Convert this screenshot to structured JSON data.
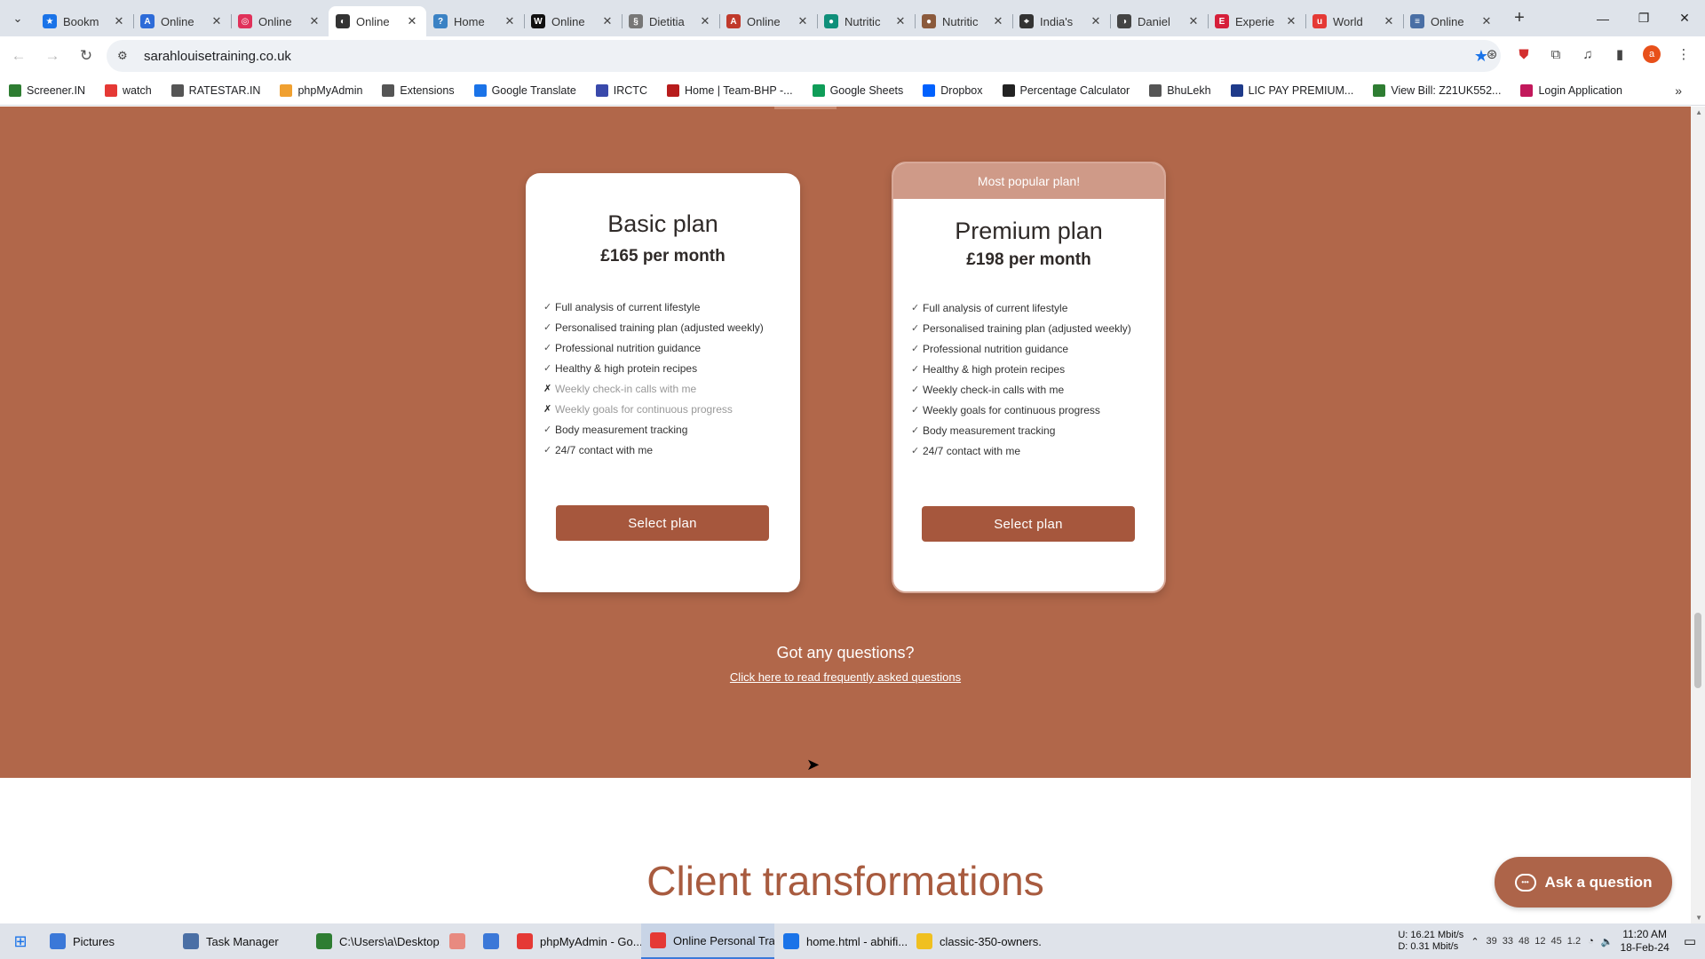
{
  "browser": {
    "tabs": [
      {
        "title": "Bookm",
        "color": "#1a73e8",
        "glyph": "★"
      },
      {
        "title": "Online",
        "color": "#2d6bd8",
        "glyph": "A"
      },
      {
        "title": "Online",
        "color": "#e0315a",
        "glyph": "◎"
      },
      {
        "title": "Online",
        "color": "#333333",
        "glyph": "◐",
        "active": true
      },
      {
        "title": "Home",
        "color": "#3b82c4",
        "glyph": "?"
      },
      {
        "title": "Online",
        "color": "#111111",
        "glyph": "W"
      },
      {
        "title": "Dietitia",
        "color": "#777777",
        "glyph": "§"
      },
      {
        "title": "Online",
        "color": "#c0392b",
        "glyph": "A"
      },
      {
        "title": "Nutritic",
        "color": "#0f8f7a",
        "glyph": "●"
      },
      {
        "title": "Nutritic",
        "color": "#8b5a3c",
        "glyph": "●"
      },
      {
        "title": "India's",
        "color": "#333333",
        "glyph": "⌖"
      },
      {
        "title": "Daniel",
        "color": "#444444",
        "glyph": "◑"
      },
      {
        "title": "Experie",
        "color": "#d61f3a",
        "glyph": "E"
      },
      {
        "title": "World",
        "color": "#e53935",
        "glyph": "u"
      },
      {
        "title": "Online",
        "color": "#4a6fa5",
        "glyph": "≡"
      }
    ],
    "new_tab": "+",
    "url": "sarahlouisetraining.co.uk",
    "bookmarks": [
      {
        "label": "Screener.IN",
        "color": "#2e7d32"
      },
      {
        "label": "watch",
        "color": "#e53935"
      },
      {
        "label": "RATESTAR.IN",
        "color": "#555555"
      },
      {
        "label": "phpMyAdmin",
        "color": "#f0a030"
      },
      {
        "label": "Extensions",
        "color": "#555555"
      },
      {
        "label": "Google Translate",
        "color": "#1a73e8"
      },
      {
        "label": "IRCTC",
        "color": "#3949ab"
      },
      {
        "label": "Home | Team-BHP -...",
        "color": "#b71c1c"
      },
      {
        "label": "Google Sheets",
        "color": "#0f9d58"
      },
      {
        "label": "Dropbox",
        "color": "#0061fe"
      },
      {
        "label": "Percentage Calculator",
        "color": "#222222"
      },
      {
        "label": "BhuLekh",
        "color": "#555555"
      },
      {
        "label": "LIC PAY PREMIUM...",
        "color": "#1e3a8a"
      },
      {
        "label": "View Bill: Z21UK552...",
        "color": "#2e7d32"
      },
      {
        "label": "Login Application",
        "color": "#c2185b"
      }
    ]
  },
  "pricing": {
    "accent": "#b1674a",
    "plans": [
      {
        "name": "Basic plan",
        "price": "£165 per month",
        "button": "Select plan",
        "features": [
          {
            "text": "Full analysis of current lifestyle",
            "included": true
          },
          {
            "text": "Personalised training plan (adjusted weekly)",
            "included": true
          },
          {
            "text": "Professional nutrition guidance",
            "included": true
          },
          {
            "text": "Healthy & high protein recipes",
            "included": true
          },
          {
            "text": "Weekly check-in calls with me",
            "included": false
          },
          {
            "text": "Weekly goals for continuous progress",
            "included": false
          },
          {
            "text": "Body measurement tracking",
            "included": true
          },
          {
            "text": "24/7 contact with me",
            "included": true
          }
        ]
      },
      {
        "badge": "Most popular plan!",
        "name": "Premium plan",
        "price": "£198 per month",
        "button": "Select plan",
        "features": [
          {
            "text": "Full analysis of current lifestyle",
            "included": true
          },
          {
            "text": "Personalised training plan (adjusted weekly)",
            "included": true
          },
          {
            "text": "Professional nutrition guidance",
            "included": true
          },
          {
            "text": "Healthy & high protein recipes",
            "included": true
          },
          {
            "text": "Weekly check-in calls with me",
            "included": true
          },
          {
            "text": "Weekly goals for continuous progress",
            "included": true
          },
          {
            "text": "Body measurement tracking",
            "included": true
          },
          {
            "text": "24/7 contact with me",
            "included": true
          }
        ]
      }
    ],
    "questions_title": "Got any questions?",
    "faq_link": "Click here to read frequently asked questions"
  },
  "transformations_title": "Client transformations",
  "ask_button": "Ask a question",
  "taskbar": {
    "items": [
      {
        "label": "Pictures",
        "color": "#3b78d8"
      },
      {
        "label": "Task Manager",
        "color": "#4a6fa5"
      },
      {
        "label": "C:\\Users\\a\\Desktop...",
        "color": "#2e7d32"
      },
      {
        "label": "",
        "color": "#e88a80"
      },
      {
        "label": "",
        "color": "#3b78d8"
      },
      {
        "label": "phpMyAdmin - Go...",
        "color": "#e53935"
      },
      {
        "label": "Online Personal Tra...",
        "color": "#e53935",
        "active": true
      },
      {
        "label": "home.html - abhifi...",
        "color": "#1a73e8"
      },
      {
        "label": "classic-350-owners...",
        "color": "#f0c020"
      }
    ],
    "net_up": "16.21 Mbit/s",
    "net_down": "0.31 Mbit/s",
    "net_up_label": "U:",
    "net_down_label": "D:",
    "tray_numbers": [
      "39",
      "33",
      "48",
      "12",
      "45",
      "1.2"
    ],
    "time": "11:20 AM",
    "date": "18-Feb-24"
  }
}
